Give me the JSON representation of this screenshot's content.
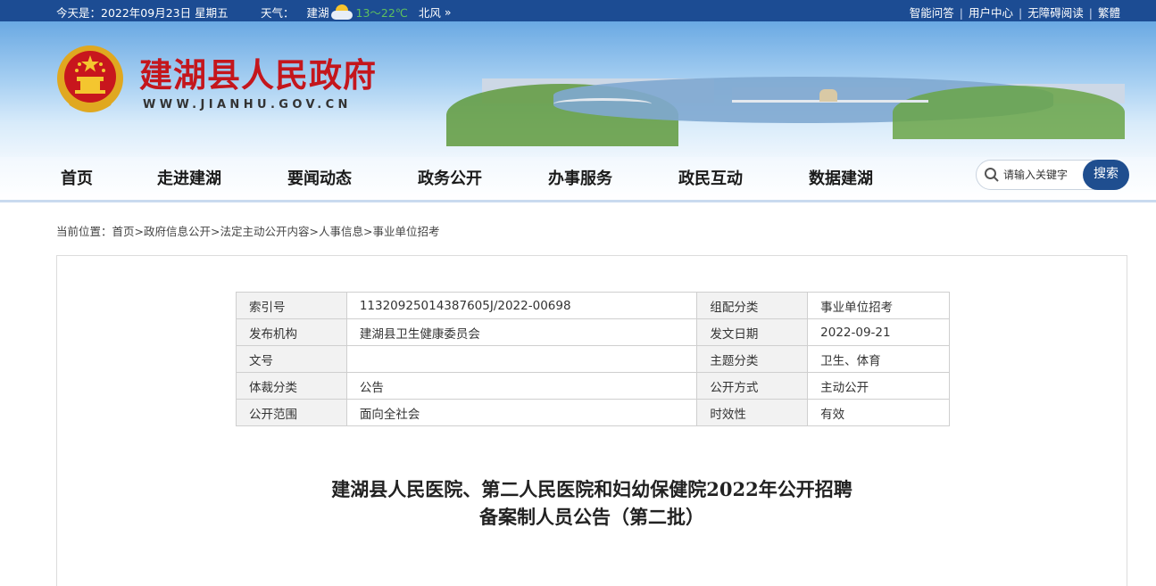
{
  "topbar": {
    "date": "今天是：2022年09月23日 星期五",
    "weather_label": "天气：",
    "city": "建湖",
    "temp": "13～22℃",
    "wind": "北风",
    "more": "»",
    "links": [
      "智能问答",
      "用户中心",
      "无障碍阅读",
      "繁體"
    ],
    "sep": "|"
  },
  "header": {
    "title": "建湖县人民政府",
    "url": "WWW.JIANHU.GOV.CN"
  },
  "nav": {
    "items": [
      "首页",
      "走进建湖",
      "要闻动态",
      "政务公开",
      "办事服务",
      "政民互动",
      "数据建湖"
    ]
  },
  "search": {
    "placeholder": "请输入关键字",
    "button": "搜索"
  },
  "breadcrumb": {
    "prefix": "当前位置：",
    "items": [
      "首页",
      "政府信息公开",
      "法定主动公开内容",
      "人事信息",
      "事业单位招考"
    ],
    "sep": ">"
  },
  "meta": {
    "rows": [
      [
        "索引号",
        "11320925014387605J/2022-00698",
        "组配分类",
        "事业单位招考"
      ],
      [
        "发布机构",
        "建湖县卫生健康委员会",
        "发文日期",
        "2022-09-21"
      ],
      [
        "文号",
        "",
        "主题分类",
        "卫生、体育"
      ],
      [
        "体裁分类",
        "公告",
        "公开方式",
        "主动公开"
      ],
      [
        "公开范围",
        "面向全社会",
        "时效性",
        "有效"
      ]
    ]
  },
  "article": {
    "title_line1": "建湖县人民医院、第二人民医院和妇幼保健院2022年公开招聘",
    "title_line2": "备案制人员公告（第二批）"
  },
  "colors": {
    "topbar": "#1c4c93",
    "title_red": "#c4161c",
    "search_button": "#1f4e8f"
  }
}
